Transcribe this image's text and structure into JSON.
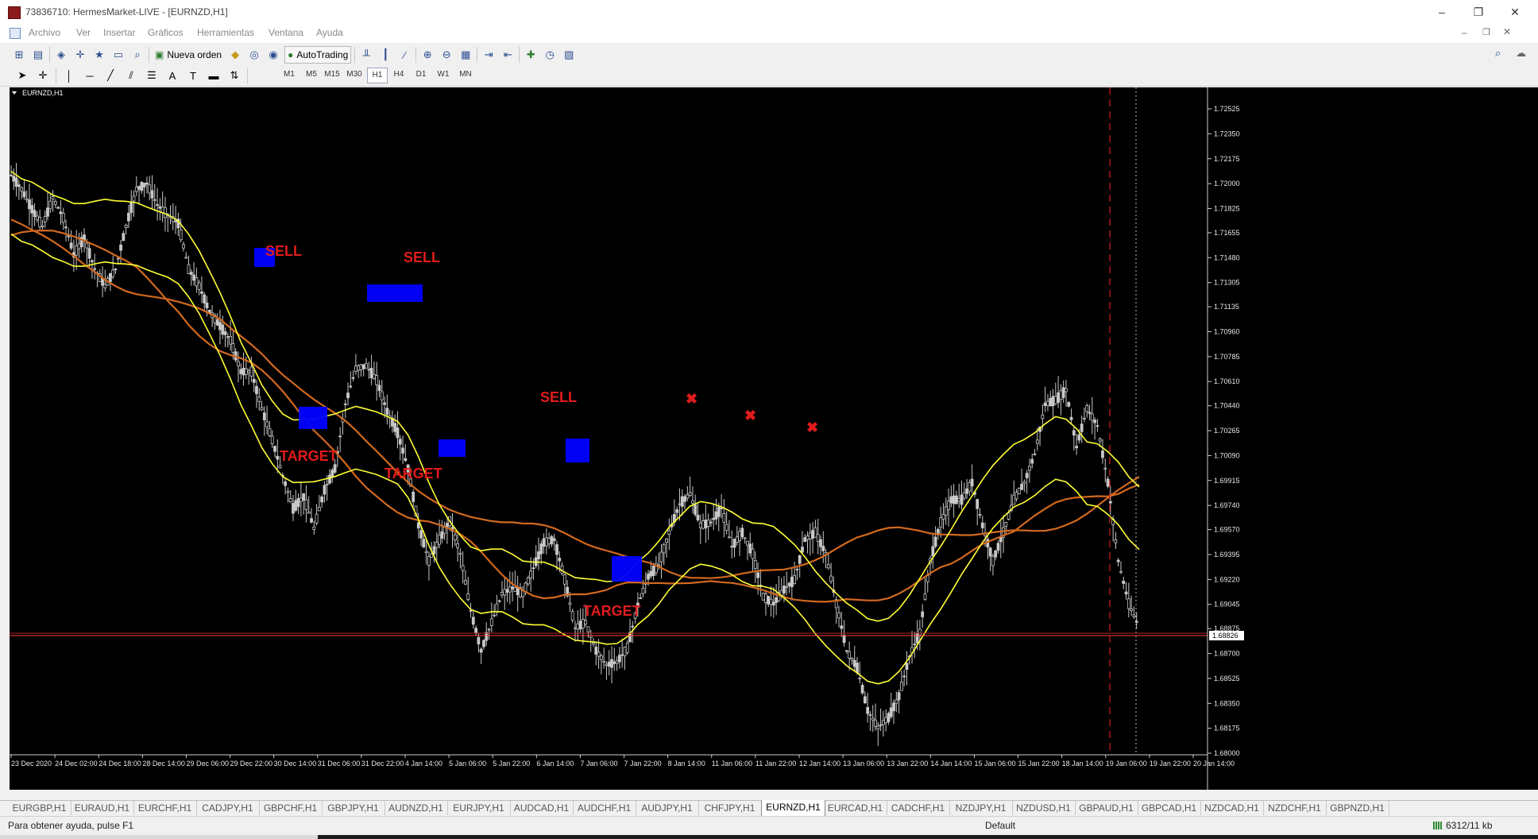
{
  "window": {
    "title": "73836710: HermesMarket-LIVE - [EURNZD,H1]",
    "controls": [
      "–",
      "❐",
      "✕"
    ]
  },
  "menu": [
    "Archivo",
    "Ver",
    "Insertar",
    "Gráficos",
    "Herramientas",
    "Ventana",
    "Ayuda"
  ],
  "toolbar": {
    "new_order_label": "Nueva orden",
    "autotrading_label": "AutoTrading"
  },
  "timeframes": [
    "M1",
    "M5",
    "M15",
    "M30",
    "H1",
    "H4",
    "D1",
    "W1",
    "MN"
  ],
  "active_timeframe": "H1",
  "chart": {
    "symbol_label": "EURNZD,H1",
    "current_price": "1.68826",
    "price_axis": [
      "1.72525",
      "1.72350",
      "1.72175",
      "1.72000",
      "1.71825",
      "1.71655",
      "1.71480",
      "1.71305",
      "1.71135",
      "1.70960",
      "1.70785",
      "1.70610",
      "1.70440",
      "1.70265",
      "1.70090",
      "1.69915",
      "1.69740",
      "1.69570",
      "1.69395",
      "1.69220",
      "1.69045",
      "1.68875",
      "1.68700",
      "1.68525",
      "1.68350",
      "1.68175",
      "1.68000"
    ],
    "time_axis": [
      "23 Dec 2020",
      "24 Dec 02:00",
      "24 Dec 18:00",
      "28 Dec 14:00",
      "29 Dec 06:00",
      "29 Dec 22:00",
      "30 Dec 14:00",
      "31 Dec 06:00",
      "31 Dec 22:00",
      "4 Jan 14:00",
      "5 Jan 06:00",
      "5 Jan 22:00",
      "6 Jan 14:00",
      "7 Jan 06:00",
      "7 Jan 22:00",
      "8 Jan 14:00",
      "11 Jan 06:00",
      "11 Jan 22:00",
      "12 Jan 14:00",
      "13 Jan 06:00",
      "13 Jan 22:00",
      "14 Jan 14:00",
      "15 Jan 06:00",
      "15 Jan 22:00",
      "18 Jan 14:00",
      "19 Jan 06:00",
      "19 Jan 22:00",
      "20 Jan 14:00"
    ],
    "annotations": [
      "SELL",
      "SELL",
      "SELL",
      "TARGET",
      "TARGET",
      "TARGET"
    ],
    "colors": {
      "background": "#000000",
      "bands": "#ffff33",
      "moving_averages": "#d2691e",
      "signal_boxes": "#0000ff",
      "labels": "#e01b1b",
      "candles": "#c8c8c8",
      "price_line": "#ff3b3b"
    }
  },
  "chart_data": {
    "type": "line",
    "title": "EURNZD,H1",
    "ylim": [
      1.68,
      1.7262
    ],
    "series": [
      {
        "values": [
          1.7206,
          1.7196,
          1.7182,
          1.717,
          1.719,
          1.7176,
          1.715,
          1.7162,
          1.714,
          1.7128,
          1.714,
          1.717,
          1.7196,
          1.72,
          1.7185,
          1.7178,
          1.7172,
          1.714,
          1.7128,
          1.711,
          1.71,
          1.709,
          1.7068,
          1.7068,
          1.7042,
          1.702,
          1.6995,
          1.6972,
          1.698,
          1.6958,
          1.6985,
          1.7,
          1.7045,
          1.707,
          1.7072,
          1.7062,
          1.704,
          1.7025,
          1.7,
          1.696,
          1.6935,
          1.695,
          1.6963,
          1.694,
          1.69,
          1.6872,
          1.6892,
          1.6912,
          1.6916,
          1.6912,
          1.693,
          1.6948,
          1.695,
          1.6922,
          1.6888,
          1.6892,
          1.6872,
          1.6862,
          1.6864,
          1.6874,
          1.6904,
          1.6924,
          1.6932,
          1.6955,
          1.6975,
          1.6982,
          1.696,
          1.6962,
          1.6972,
          1.6945,
          1.6955,
          1.694,
          1.691,
          1.6905,
          1.6915,
          1.6922,
          1.695,
          1.6955,
          1.694,
          1.6905,
          1.6872,
          1.686,
          1.683,
          1.6818,
          1.6825,
          1.684,
          1.6868,
          1.6885,
          1.6935,
          1.6962,
          1.6978,
          1.6978,
          1.699,
          1.696,
          1.6935,
          1.6955,
          1.6978,
          1.699,
          1.701,
          1.7045,
          1.7048,
          1.7055,
          1.7015,
          1.7042,
          1.703,
          1.699,
          1.6935,
          1.6905,
          1.6888
        ]
      }
    ]
  },
  "tabs": [
    "EURGBP,H1",
    "EURAUD,H1",
    "EURCHF,H1",
    "CADJPY,H1",
    "GBPCHF,H1",
    "GBPJPY,H1",
    "AUDNZD,H1",
    "EURJPY,H1",
    "AUDCAD,H1",
    "AUDCHF,H1",
    "AUDJPY,H1",
    "CHFJPY,H1",
    "EURNZD,H1",
    "EURCAD,H1",
    "CADCHF,H1",
    "NZDJPY,H1",
    "NZDUSD,H1",
    "GBPAUD,H1",
    "GBPCAD,H1",
    "NZDCAD,H1",
    "NZDCHF,H1",
    "GBPNZD,H1"
  ],
  "active_tab": "EURNZD,H1",
  "status": {
    "help": "Para obtener ayuda, pulse F1",
    "profile": "Default",
    "traffic": "6312/11 kb"
  }
}
